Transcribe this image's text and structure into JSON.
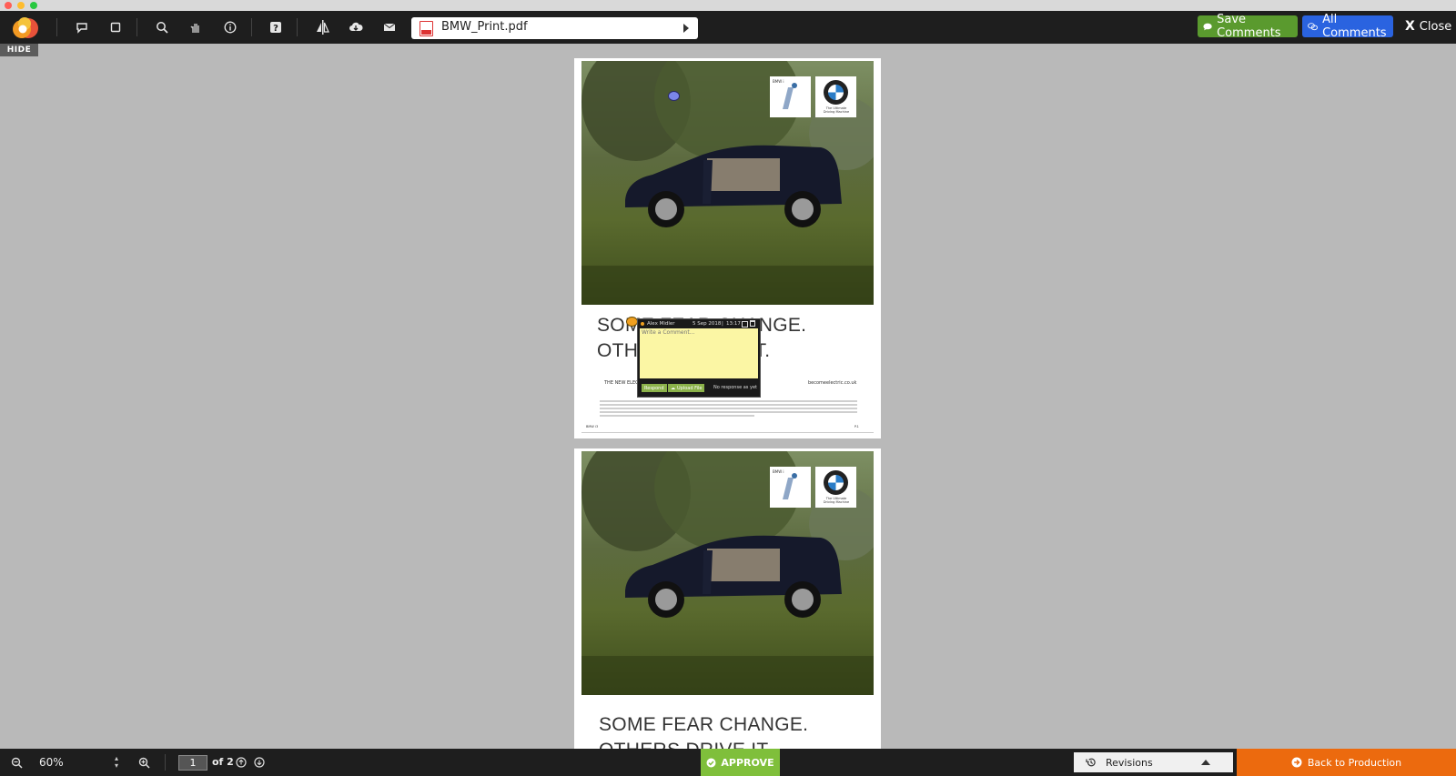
{
  "window": {
    "title": ""
  },
  "toolbar": {
    "icons": [
      "app-logo",
      "speech-bubble-icon",
      "square-icon",
      "search-icon",
      "pan-hand-icon",
      "info-icon",
      "help-icon",
      "compare-icon",
      "cloud-download-icon",
      "mail-icon"
    ],
    "file_name": "BMW_Print.pdf",
    "save_comments_label": "Save Comments",
    "all_comments_label": "All Comments",
    "close_label": "Close",
    "close_x": "X",
    "colors": {
      "save_comments": "#5a9a2e",
      "all_comments": "#2a63e0"
    }
  },
  "sidebar": {
    "hide_label": "HIDE"
  },
  "document": {
    "pages": [
      {
        "logo_i_caption": "BMW i",
        "logo_bmw_caption": "The Ultimate Driving Machine",
        "headline_line1": "SOME FEAR CHANGE.",
        "headline_line2": "OTHERS DRIVE IT.",
        "subline": "THE NEW ELECTRIC BMW i3",
        "website": "becomeelectric.co.uk",
        "footer_left": "BMW i3",
        "footer_right": "P.1"
      },
      {
        "logo_i_caption": "BMW i",
        "logo_bmw_caption": "The Ultimate Driving Machine",
        "headline_line1": "SOME FEAR CHANGE.",
        "headline_line2": "OTHERS DRIVE IT."
      }
    ],
    "comment": {
      "author": "Alex Midler",
      "date": "5 Sep 2018",
      "time": "13:17",
      "placeholder": "Write a Comment...",
      "respond_label": "Respond",
      "upload_label": "Upload File",
      "status": "No response as yet"
    }
  },
  "bottom_bar": {
    "zoom_value": "60%",
    "page_current": "1",
    "page_total_label": "of 2",
    "approve_label": "APPROVE",
    "revisions_label": "Revisions",
    "back_label": "Back to Production",
    "colors": {
      "approve": "#7fbf3b",
      "back": "#ec6a0e"
    }
  }
}
